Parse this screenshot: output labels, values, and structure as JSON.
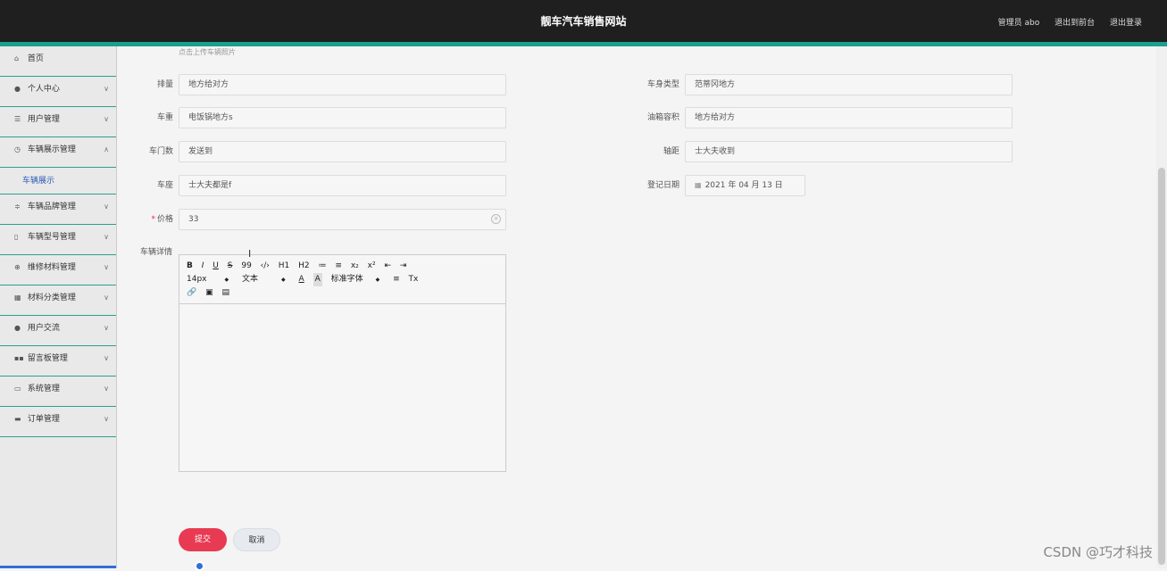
{
  "header": {
    "title": "靓车汽车销售网站",
    "user": "管理员 abo",
    "back": "退出到前台",
    "logout": "退出登录"
  },
  "sidebar": {
    "items": [
      {
        "label": "首页",
        "icon": "home-icon"
      },
      {
        "label": "个人中心",
        "icon": "user-icon"
      },
      {
        "label": "用户管理",
        "icon": "list-icon"
      },
      {
        "label": "车辆展示管理",
        "icon": "clock-icon",
        "expanded": true
      },
      {
        "label": "车辆品牌管理",
        "icon": "sliders-icon"
      },
      {
        "label": "车辆型号管理",
        "icon": "tag-icon"
      },
      {
        "label": "维修材料管理",
        "icon": "globe-icon"
      },
      {
        "label": "材料分类管理",
        "icon": "grid-icon"
      },
      {
        "label": "用户交流",
        "icon": "user-icon"
      },
      {
        "label": "留言板管理",
        "icon": "apps-icon"
      },
      {
        "label": "系统管理",
        "icon": "message-icon"
      },
      {
        "label": "订单管理",
        "icon": "chat-icon"
      }
    ],
    "sub_item": "车辆展示"
  },
  "form": {
    "upload_hint": "点击上传车辆照片",
    "fields": {
      "displacement": {
        "label": "排量",
        "value": "地方给对方"
      },
      "body_type": {
        "label": "车身类型",
        "value": "范蒂冈地方"
      },
      "weight": {
        "label": "车重",
        "value": "电饭锅地方s"
      },
      "fuel_capacity": {
        "label": "油箱容积",
        "value": "地方给对方"
      },
      "doors": {
        "label": "车门数",
        "value": "发送到"
      },
      "wheelbase": {
        "label": "轴距",
        "value": "士大夫收到"
      },
      "seats": {
        "label": "车座",
        "value": "士大夫都是f"
      },
      "reg_date": {
        "label": "登记日期",
        "value": "2021 年 04 月 13 日"
      },
      "price": {
        "label": "价格",
        "value": "33",
        "required_mark": "*"
      }
    },
    "details_label": "车辆详情",
    "editor": {
      "font_size": "14px",
      "block_type": "文本",
      "font_family": "标准字体",
      "tools_row1": [
        "B",
        "I",
        "U",
        "S",
        "99",
        "‹/›",
        "H1",
        "H2",
        "≔",
        "≡",
        "x₂",
        "x²",
        "⇤",
        "⇥"
      ],
      "tools_row2_extra": [
        "A",
        "A",
        "≡",
        "Tx"
      ]
    },
    "submit": "提交",
    "cancel": "取消"
  },
  "watermark": "CSDN @巧才科技",
  "colors": {
    "accent": "#1aa08f",
    "submit": "#e83a52",
    "header": "#1f1f1f"
  }
}
